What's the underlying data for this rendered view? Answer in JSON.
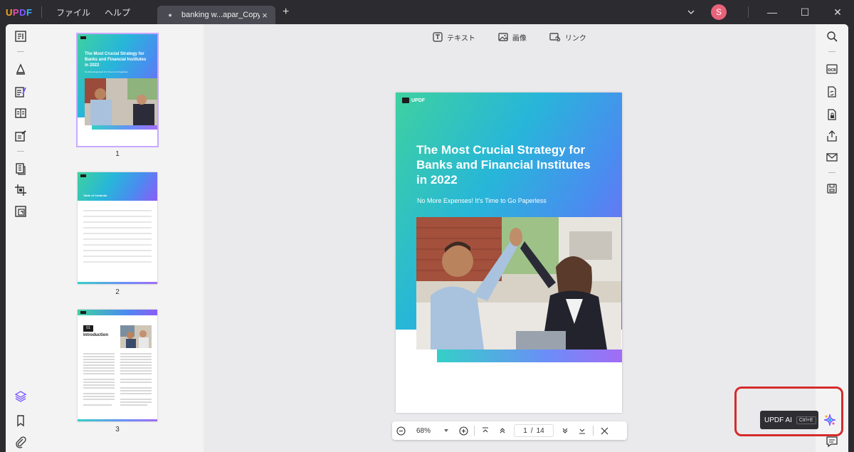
{
  "app": {
    "logo": "UPDF",
    "menus": [
      "ファイル",
      "ヘルプ"
    ],
    "tab_title": "banking w...apar_Copy",
    "user_initial": "S"
  },
  "toolbar": {
    "text_label": "テキスト",
    "image_label": "画像",
    "link_label": "リンク"
  },
  "thumbnails": [
    {
      "number": "1",
      "title": "The Most Crucial Strategy for Banks and Financial Institutes in 2022",
      "subtitle": "No More Expenses! It's Time to Go Paperless"
    },
    {
      "number": "2",
      "title": "Table of Contents"
    },
    {
      "number": "3",
      "chapter": "01",
      "title": "Introduction"
    }
  ],
  "document": {
    "brand": "UPDF",
    "title": "The Most Crucial Strategy for Banks and Financial Institutes in 2022",
    "subtitle": "No More Expenses! It's Time to Go Paperless"
  },
  "navigation": {
    "zoom": "68%",
    "current_page": "1",
    "separator": "/",
    "total_pages": "14"
  },
  "ai": {
    "tooltip_label": "UPDF AI",
    "shortcut": "Ctrl+E"
  },
  "colors": {
    "accent": "#7b5cff",
    "highlight": "#d62b2b"
  }
}
